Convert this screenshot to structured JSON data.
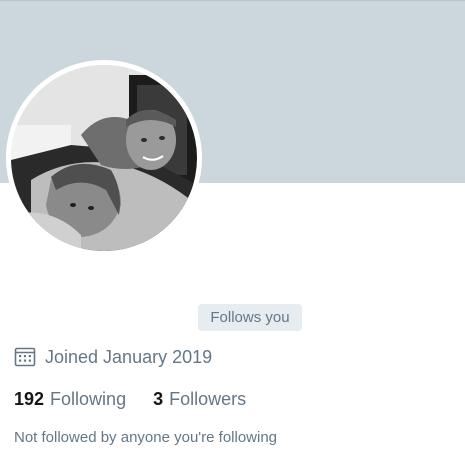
{
  "profile": {
    "avatar_alt": "profile photo",
    "follows_you_label": "Follows you",
    "joined_text": "Joined January 2019",
    "following_count": "192",
    "following_label": "Following",
    "followers_count": "3",
    "followers_label": "Followers",
    "mutual_text": "Not followed by anyone you're following"
  },
  "icons": {
    "calendar": "calendar-icon"
  },
  "colors": {
    "banner": "#ccd6dd",
    "secondary_text": "#657786",
    "primary_text": "#14171a",
    "badge_bg": "#e6ecf0"
  }
}
